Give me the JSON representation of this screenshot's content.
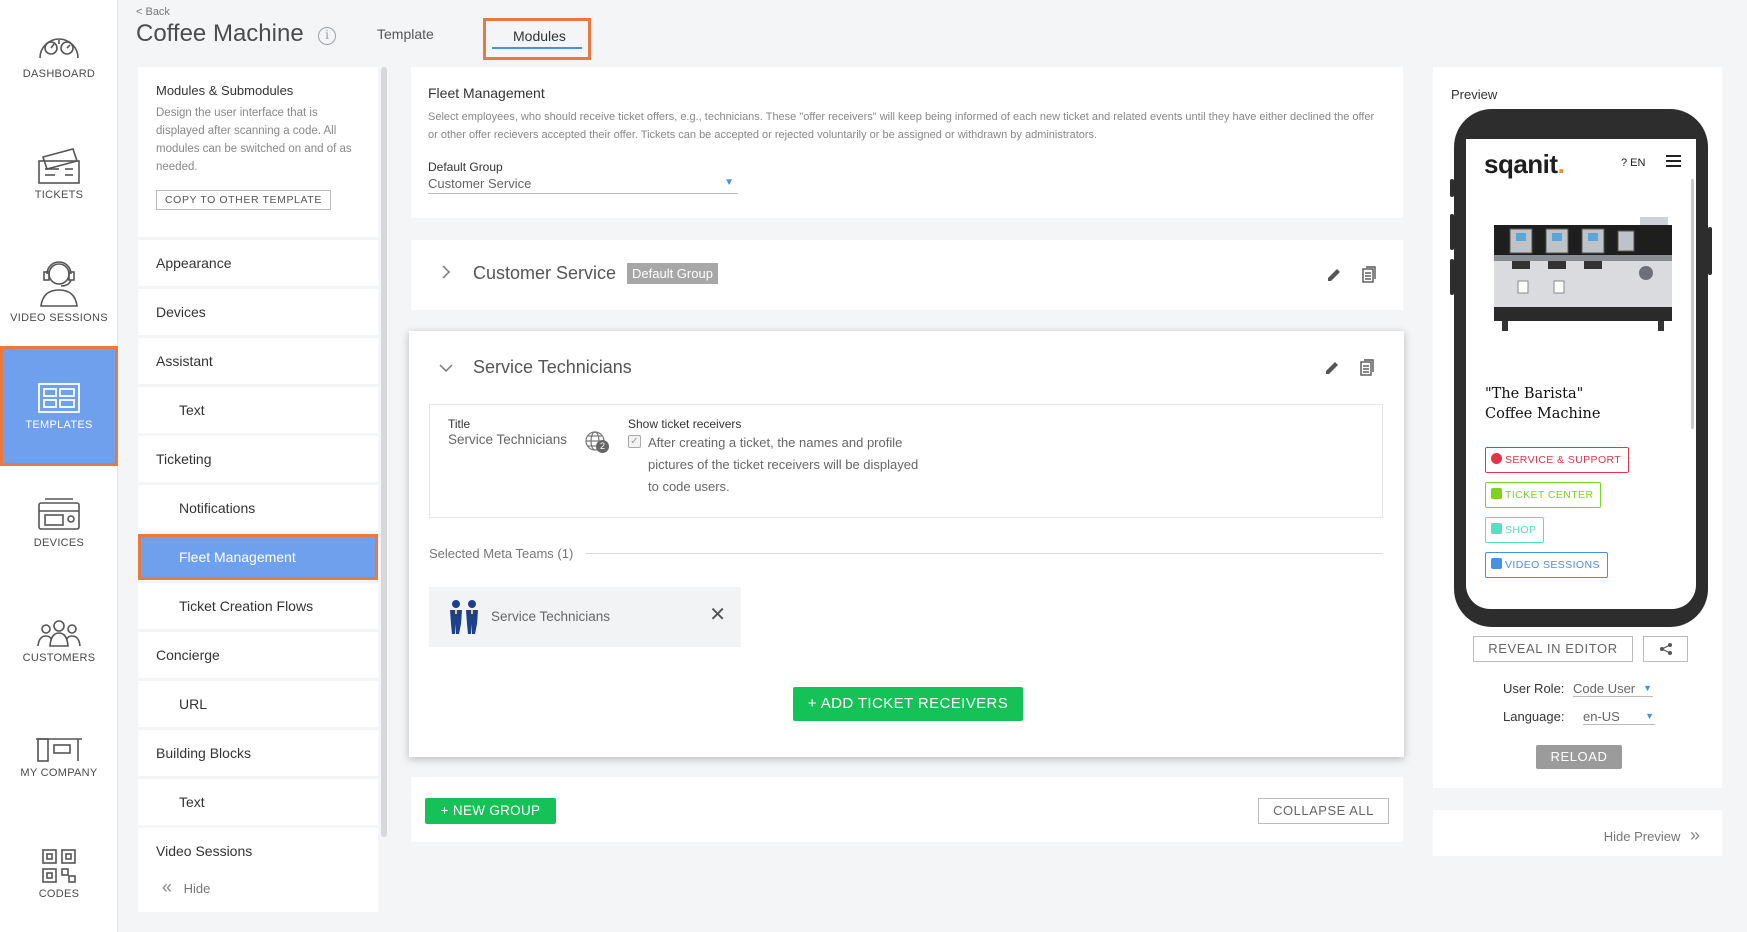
{
  "rail": {
    "items": [
      {
        "label": "DASHBOARD",
        "icon": "dashboard-icon"
      },
      {
        "label": "TICKETS",
        "icon": "tickets-icon"
      },
      {
        "label": "VIDEO SESSIONS",
        "icon": "headset-agent-icon"
      },
      {
        "label": "TEMPLATES",
        "icon": "templates-icon",
        "active": true
      },
      {
        "label": "DEVICES",
        "icon": "devices-icon"
      },
      {
        "label": "CUSTOMERS",
        "icon": "customers-icon"
      },
      {
        "label": "MY COMPANY",
        "icon": "desk-icon"
      },
      {
        "label": "CODES",
        "icon": "qr-code-icon"
      }
    ]
  },
  "header": {
    "back": "< Back",
    "title": "Coffee Machine",
    "info_icon": "i",
    "tabs": [
      {
        "label": "Template"
      },
      {
        "label": "Modules",
        "active": true
      }
    ]
  },
  "modules": {
    "heading": "Modules & Submodules",
    "description": "Design the user interface that is displayed after scanning a code. All modules can be switched on and of as needed.",
    "copy_button": "COPY TO OTHER TEMPLATE",
    "items": [
      {
        "label": "Appearance",
        "level": 0
      },
      {
        "label": "Devices",
        "level": 0
      },
      {
        "label": "Assistant",
        "level": 0
      },
      {
        "label": "Text",
        "level": 1
      },
      {
        "label": "Ticketing",
        "level": 0
      },
      {
        "label": "Notifications",
        "level": 1
      },
      {
        "label": "Fleet Management",
        "level": 1,
        "active": true
      },
      {
        "label": "Ticket Creation Flows",
        "level": 1
      },
      {
        "label": "Concierge",
        "level": 0
      },
      {
        "label": "URL",
        "level": 1
      },
      {
        "label": "Building Blocks",
        "level": 0
      },
      {
        "label": "Text",
        "level": 1
      },
      {
        "label": "Video Sessions",
        "level": 0
      }
    ],
    "hide": "Hide"
  },
  "fleet": {
    "title": "Fleet Management",
    "description": "Select employees, who should receive ticket offers, e.g., technicians. These \"offer receivers\" will keep being informed of each new ticket and related events until they have either declined the offer or other offer recievers accepted their offer. Tickets can be accepted or rejected voluntarily or be assigned or withdrawn by administrators.",
    "default_group_label": "Default Group",
    "default_group_value": "Customer Service"
  },
  "groups": {
    "customer_service": {
      "title": "Customer Service",
      "badge": "Default Group"
    },
    "service_technicians": {
      "title": "Service Technicians",
      "title_label": "Title",
      "title_value": "Service Technicians",
      "translations_count": "2",
      "show_receivers_label": "Show ticket receivers",
      "show_receivers_text": "After creating a ticket, the names and profile pictures of the ticket receivers will be displayed to code users.",
      "show_receivers_checked": true,
      "meta_teams_label": "Selected Meta Teams (1)",
      "team_name": "Service Technicians",
      "add_button": "+ ADD TICKET RECEIVERS"
    }
  },
  "footer": {
    "new_group": "+ NEW GROUP",
    "collapse_all": "COLLAPSE ALL"
  },
  "preview": {
    "label": "Preview",
    "brand": "sqanit",
    "brand_dot": ".",
    "lang": "? EN",
    "heading_line1": "\"The Barista\"",
    "heading_line2": "Coffee Machine",
    "buttons": [
      {
        "label": "SERVICE & SUPPORT",
        "color": "#e2344a"
      },
      {
        "label": "TICKET CENTER",
        "color": "#7ed321"
      },
      {
        "label": "SHOP",
        "color": "#50e3c2"
      },
      {
        "label": "VIDEO SESSIONS",
        "color": "#4a90e2"
      }
    ],
    "reveal": "REVEAL IN EDITOR",
    "user_role_label": "User Role:",
    "user_role_value": "Code User",
    "language_label": "Language:",
    "language_value": "en-US",
    "reload": "RELOAD",
    "hide_preview": "Hide Preview"
  },
  "colors": {
    "accent_blue": "#6ea0ee",
    "highlight_orange": "#e9793f",
    "green": "#15c257"
  }
}
